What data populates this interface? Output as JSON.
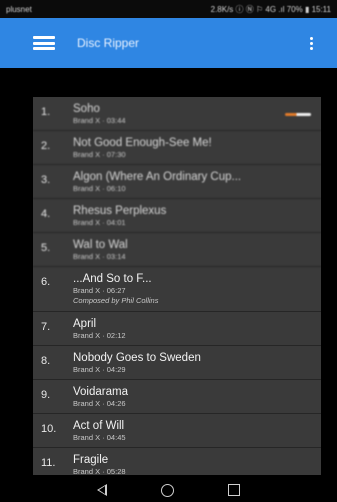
{
  "status_bar": {
    "carrier": "plusnet",
    "right": "2.8K/s ⓘ Ⓝ ⚐ 4G .ıl 70% ▮ 15:11"
  },
  "app_bar": {
    "title": "Disc Ripper"
  },
  "tracks": [
    {
      "num": "1.",
      "name": "Soho",
      "meta": "Brand X · 03:44",
      "blurred": true,
      "playing": true
    },
    {
      "num": "2.",
      "name": "Not Good Enough-See Me!",
      "meta": "Brand X · 07:30",
      "blurred": true
    },
    {
      "num": "3.",
      "name": "Algon (Where An Ordinary Cup...",
      "meta": "Brand X · 06:10",
      "blurred": true
    },
    {
      "num": "4.",
      "name": "Rhesus Perplexus",
      "meta": "Brand X · 04:01",
      "blurred": true
    },
    {
      "num": "5.",
      "name": "Wal to Wal",
      "meta": "Brand X · 03:14",
      "blurred": true
    },
    {
      "num": "6.",
      "name": "...And So to F...",
      "meta": "Brand X · 06:27",
      "composer": "Composed by Phil Collins"
    },
    {
      "num": "7.",
      "name": "April",
      "meta": "Brand X · 02:12"
    },
    {
      "num": "8.",
      "name": "Nobody Goes to Sweden",
      "meta": "Brand X · 04:29"
    },
    {
      "num": "9.",
      "name": "Voidarama",
      "meta": "Brand X · 04:26"
    },
    {
      "num": "10.",
      "name": "Act of Will",
      "meta": "Brand X · 04:45"
    },
    {
      "num": "11.",
      "name": "Fragile",
      "meta": "Brand X · 05:28"
    }
  ],
  "playback": {
    "progress": 0.45,
    "color": "#e07a2a"
  },
  "colors": {
    "app_bar": "#2f86e3",
    "list_bg": "#3a3a3a"
  },
  "nav_bar": {
    "back_icon": "back-triangle-icon",
    "home_icon": "home-circle-icon",
    "recent_icon": "recent-apps-square-icon"
  }
}
